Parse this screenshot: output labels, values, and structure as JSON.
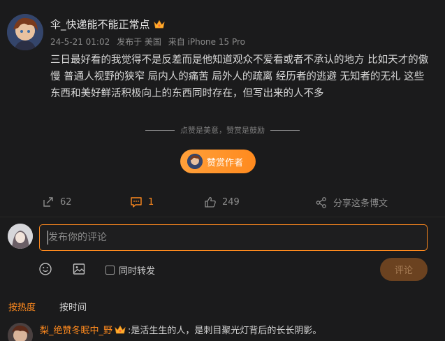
{
  "post": {
    "username": "伞_快递能不能正常点",
    "time": "24-5-21 01:02",
    "location": "发布于 美国",
    "device": "来自 iPhone 15 Pro",
    "text": "三日最好看的我觉得不是反差而是他知道观众不爱看或者不承认的地方 比如天才的傲慢 普通人视野的狭窄 局内人的痛苦 局外人的疏离 经历者的逃避 无知者的无礼 这些东西和美好鲜活积极向上的东西同时存在，但写出来的人不多"
  },
  "reward": {
    "hint": "点赞是美意，赞赏是鼓励",
    "button_label": "赞赏作者"
  },
  "actions": {
    "repost_count": "62",
    "comment_count": "1",
    "like_count": "249",
    "share_label": "分享这条博文"
  },
  "composer": {
    "placeholder": "发布你的评论",
    "repost_label": "同时转发",
    "submit_label": "评论"
  },
  "sort": {
    "hot_label": "按热度",
    "time_label": "按时间"
  },
  "comments": [
    {
      "username": "梨_绝赞冬眠中_野",
      "text": ":是活生生的人，是刺目聚光灯背后的长长阴影。"
    }
  ],
  "colors": {
    "accent": "#ff8a1e",
    "background": "#1b1b1c"
  }
}
